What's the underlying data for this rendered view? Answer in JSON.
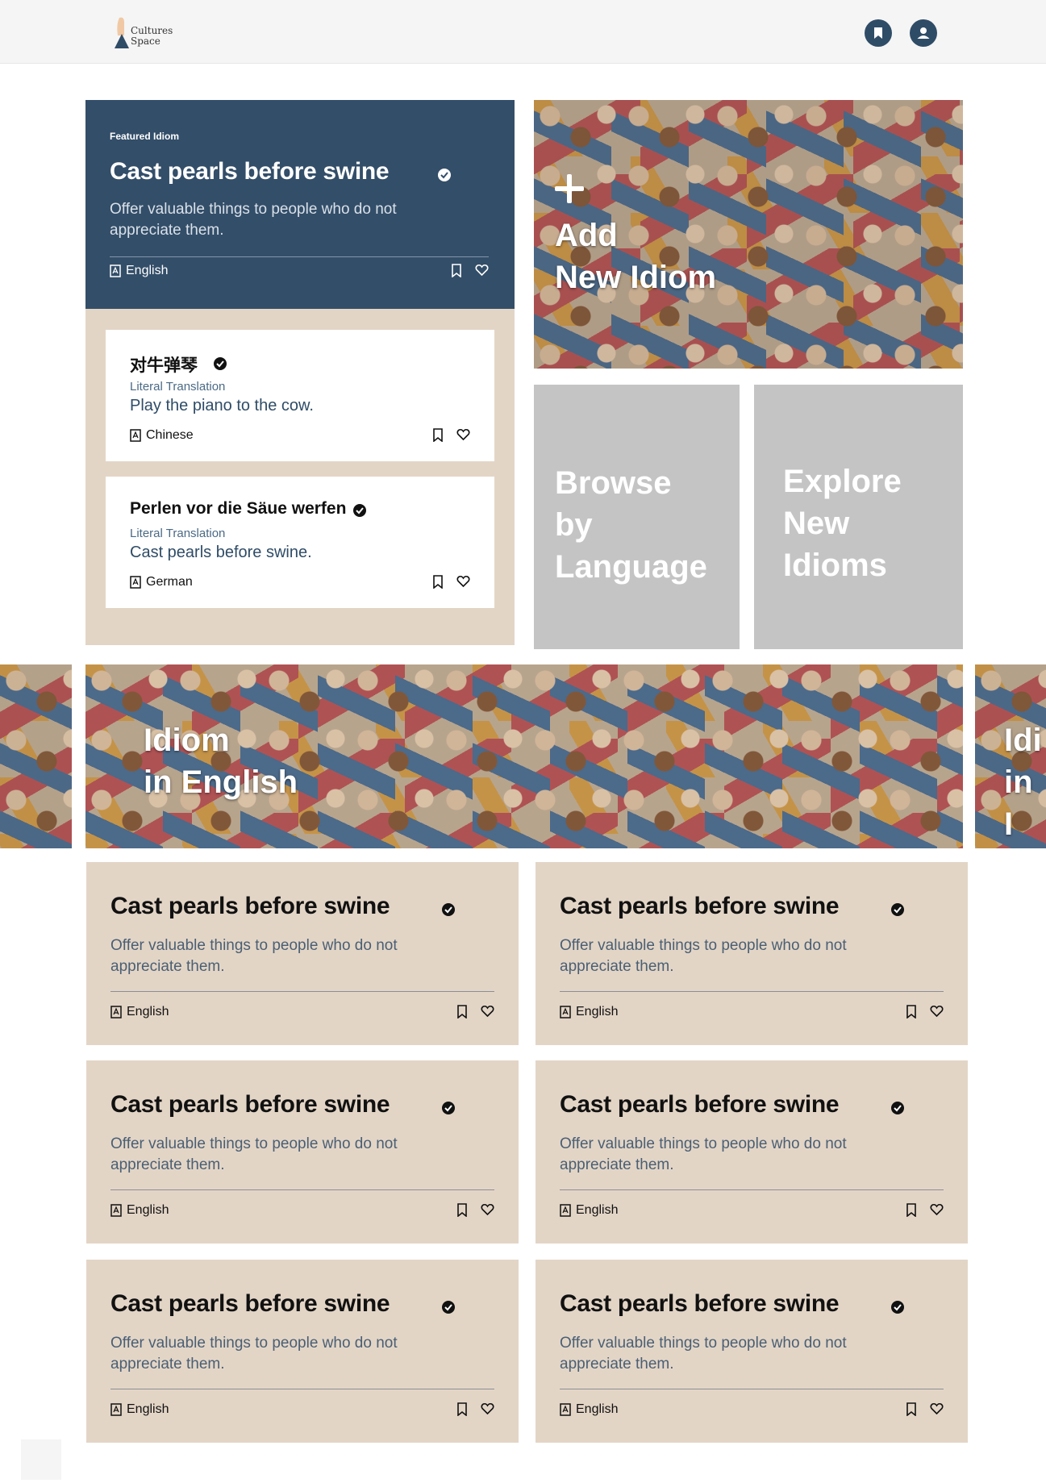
{
  "header": {
    "logo_text_line1": "Cultures",
    "logo_text_line2": "Space",
    "icons": [
      "bookmark-icon",
      "account-icon"
    ]
  },
  "featured": {
    "label": "Featured Idiom",
    "title": "Cast pearls before swine",
    "description": "Offer valuable things to people who do not appreciate them.",
    "language": "English"
  },
  "translations": [
    {
      "title": "对牛弹琴",
      "literal_label": "Literal Translation",
      "literal_text": "Play the piano to the cow.",
      "language": "Chinese"
    },
    {
      "title": "Perlen vor die Säue werfen",
      "literal_label": "Literal Translation",
      "literal_text": "Cast pearls before swine.",
      "language": "German"
    }
  ],
  "tiles": {
    "add": "Add\nNew Idiom",
    "browse": "Browse\nby\nLanguage",
    "explore": "Explore\nNew\nIdioms"
  },
  "banner": {
    "title": "Idiom\nin English",
    "right_peek": "Idi\nin I"
  },
  "idioms": [
    {
      "title": "Cast pearls before swine",
      "description": "Offer valuable things to people who do not appreciate them.",
      "language": "English"
    },
    {
      "title": "Cast pearls before swine",
      "description": "Offer valuable things to people who do not appreciate them.",
      "language": "English"
    },
    {
      "title": "Cast pearls before swine",
      "description": "Offer valuable things to people who do not appreciate them.",
      "language": "English"
    },
    {
      "title": "Cast pearls before swine",
      "description": "Offer valuable things to people who do not appreciate them.",
      "language": "English"
    },
    {
      "title": "Cast pearls before swine",
      "description": "Offer valuable things to people who do not appreciate them.",
      "language": "English"
    },
    {
      "title": "Cast pearls before swine",
      "description": "Offer valuable things to people who do not appreciate them.",
      "language": "English"
    }
  ],
  "colors": {
    "navy": "#334e69",
    "beige": "#e3d5c6",
    "tile_gray": "#c4c4c4"
  }
}
